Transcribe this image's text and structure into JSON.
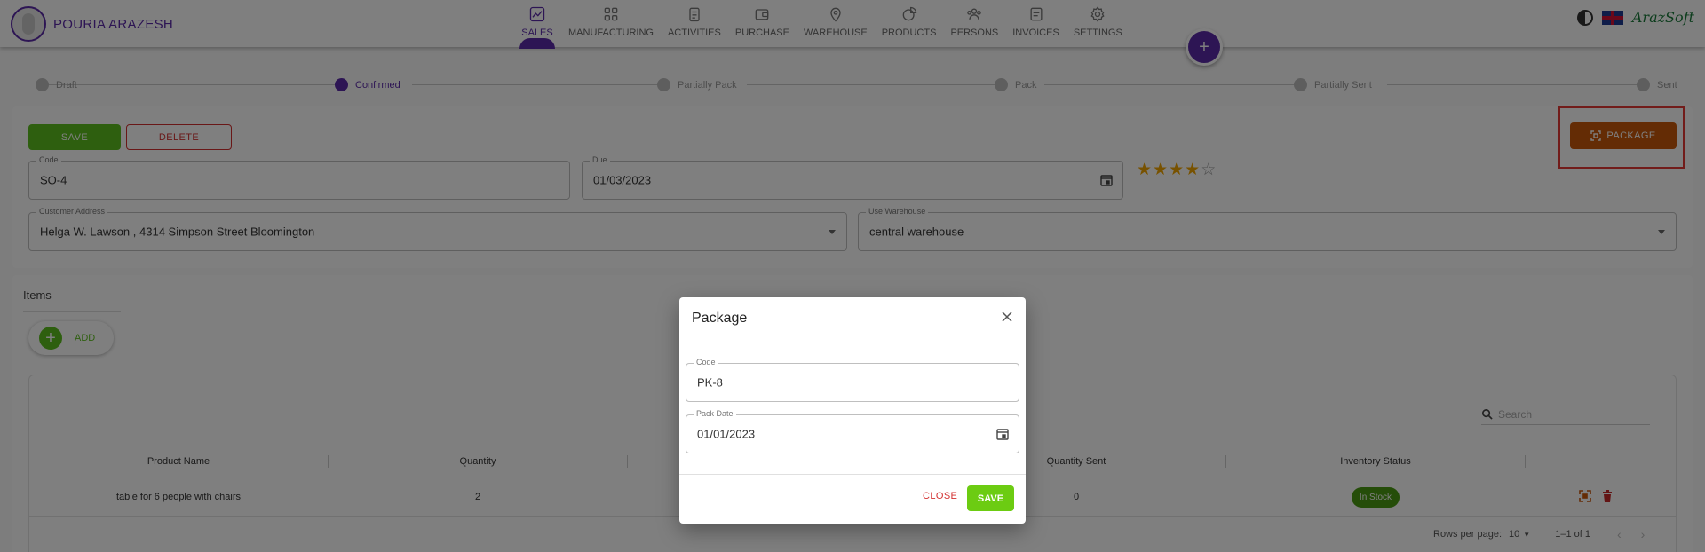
{
  "header": {
    "brand_name": "POURIA ARAZESH",
    "logo_text": "ArazSoft",
    "nav": [
      {
        "label": "SALES",
        "icon": "chart-line-icon",
        "active": true
      },
      {
        "label": "MANUFACTURING",
        "icon": "grid-icon"
      },
      {
        "label": "ACTIVITIES",
        "icon": "clipboard-icon"
      },
      {
        "label": "PURCHASE",
        "icon": "wallet-icon"
      },
      {
        "label": "WAREHOUSE",
        "icon": "location-pin-icon"
      },
      {
        "label": "PRODUCTS",
        "icon": "pie-chart-icon"
      },
      {
        "label": "PERSONS",
        "icon": "people-icon"
      },
      {
        "label": "INVOICES",
        "icon": "document-icon"
      },
      {
        "label": "SETTINGS",
        "icon": "gear-icon"
      }
    ],
    "fab_label": "+"
  },
  "stepper": {
    "steps": [
      {
        "label": "Draft"
      },
      {
        "label": "Confirmed",
        "active": true
      },
      {
        "label": "Partially Pack"
      },
      {
        "label": "Pack"
      },
      {
        "label": "Partially Sent"
      },
      {
        "label": "Sent"
      }
    ]
  },
  "form": {
    "save_label": "SAVE",
    "delete_label": "DELETE",
    "package_label": "PACKAGE",
    "code_label": "Code",
    "code_value": "SO-4",
    "due_label": "Due",
    "due_value": "01/03/2023",
    "rating": 4,
    "rating_max": 5,
    "customer_address_label": "Customer Address",
    "customer_address_value": "Helga W. Lawson , 4314 Simpson Street Bloomington",
    "warehouse_label": "Use Warehouse",
    "warehouse_value": "central warehouse"
  },
  "items": {
    "title": "Items",
    "add_label": "ADD",
    "search_placeholder": "Search",
    "columns": [
      "Product Name",
      "Quantity",
      "",
      "",
      "Quantity Sent",
      "Inventory Status",
      ""
    ],
    "rows": [
      {
        "product": "table for 6 people with chairs",
        "quantity": "2",
        "quantity_sent": "0",
        "status": "In Stock"
      }
    ],
    "pager": {
      "rows_per_page_label": "Rows per page:",
      "rows_per_page": "10",
      "range": "1–1 of 1"
    }
  },
  "dialog": {
    "title": "Package",
    "code_label": "Code",
    "code_value": "PK-8",
    "pack_date_label": "Pack Date",
    "pack_date_value": "01/01/2023",
    "close_label": "CLOSE",
    "save_label": "SAVE"
  },
  "colors": {
    "primary": "#5b2aa8",
    "save_green": "#5cbf1e",
    "delete_red": "#d32f2f",
    "package_orange": "#c9590a",
    "star_gold": "#f0a500",
    "highlight_red": "#e53935"
  }
}
